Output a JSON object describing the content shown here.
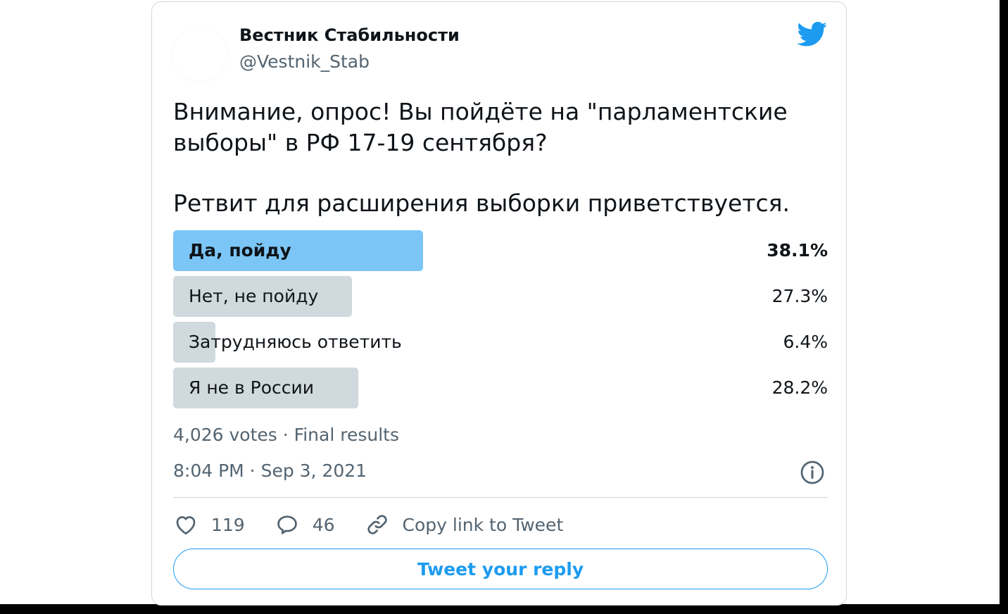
{
  "author": {
    "display_name": "Вестник Стабильности",
    "handle": "@Vestnik_Stab"
  },
  "tweet": {
    "text_line1": "Внимание, опрос! Вы пойдёте на \"парламентские выборы\" в РФ 17-19 сентября?",
    "text_line2": "Ретвит для расширения выборки приветствуется."
  },
  "poll": {
    "options": [
      {
        "label": "Да, пойду",
        "percent_text": "38.1%",
        "percent": 38.1,
        "winner": true
      },
      {
        "label": "Нет, не пойду",
        "percent_text": "27.3%",
        "percent": 27.3,
        "winner": false
      },
      {
        "label": "Затрудняюсь ответить",
        "percent_text": "6.4%",
        "percent": 6.4,
        "winner": false
      },
      {
        "label": "Я не в России",
        "percent_text": "28.2%",
        "percent": 28.2,
        "winner": false
      }
    ],
    "summary": "4,026 votes · Final results"
  },
  "timestamp": "8:04 PM · Sep 3, 2021",
  "actions": {
    "like_count": "119",
    "reply_count": "46",
    "copy_link_label": "Copy link to Tweet"
  },
  "reply_button_label": "Tweet your reply",
  "icons": {
    "brand": "twitter-bird-icon",
    "info": "info-icon",
    "like": "heart-icon",
    "reply": "speech-bubble-icon",
    "copy_link": "link-icon"
  },
  "colors": {
    "brand_blue": "#1d9bf0",
    "poll_winner": "#7cc6f7",
    "poll_other": "#cfd9de",
    "secondary_text": "#536471",
    "primary_text": "#0f1419"
  }
}
